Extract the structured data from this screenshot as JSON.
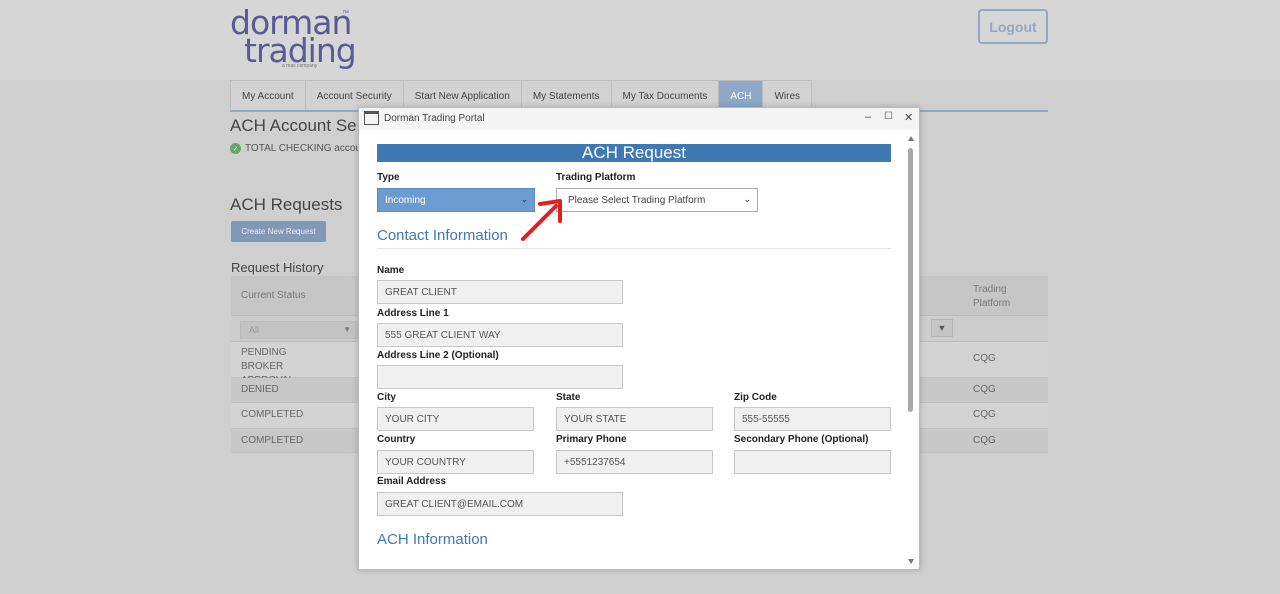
{
  "brand": {
    "line1": "dorman",
    "line2": "trading",
    "tagline": "a mas company"
  },
  "header": {
    "logout_label": "Logout"
  },
  "tabs": [
    {
      "label": "My Account",
      "active": false
    },
    {
      "label": "Account Security",
      "active": false
    },
    {
      "label": "Start New Application",
      "active": false
    },
    {
      "label": "My Statements",
      "active": false
    },
    {
      "label": "My Tax Documents",
      "active": false
    },
    {
      "label": "ACH",
      "active": true
    },
    {
      "label": "Wires",
      "active": false
    }
  ],
  "page": {
    "title": "ACH Account Se",
    "account_line": "TOTAL CHECKING accou",
    "ach_requests_title": "ACH Requests",
    "create_button": "Create New Request",
    "history_title": "Request History"
  },
  "table": {
    "col_status": "Current Status",
    "col_platform": "Trading Platform",
    "filter_value": "All",
    "rows": [
      {
        "status": "PENDING BROKER APPROVAL",
        "platform": "CQG"
      },
      {
        "status": "DENIED",
        "platform": "CQG"
      },
      {
        "status": "COMPLETED",
        "platform": "CQG"
      },
      {
        "status": "COMPLETED",
        "platform": "CQG"
      }
    ]
  },
  "modal": {
    "window_title": "Dorman Trading Portal",
    "banner": "ACH Request",
    "type_label": "Type",
    "type_value": "Incoming",
    "platform_label": "Trading Platform",
    "platform_placeholder": "Please Select Trading Platform",
    "contact_section": "Contact Information",
    "name_label": "Name",
    "name_value": "GREAT CLIENT",
    "addr1_label": "Address Line 1",
    "addr1_value": "555 GREAT CLIENT WAY",
    "addr2_label": "Address Line 2 (Optional)",
    "addr2_value": "",
    "city_label": "City",
    "city_value": "YOUR CITY",
    "state_label": "State",
    "state_value": "YOUR STATE",
    "zip_label": "Zip Code",
    "zip_value": "555-55555",
    "country_label": "Country",
    "country_value": "YOUR COUNTRY",
    "phone_label": "Primary Phone",
    "phone_value": "+5551237654",
    "phone2_label": "Secondary Phone (Optional)",
    "phone2_value": "",
    "email_label": "Email Address",
    "email_value": "GREAT CLIENT@EMAIL.COM",
    "ach_section": "ACH Information"
  },
  "colors": {
    "accent": "#3f79b3",
    "annotation": "#e0201f"
  }
}
